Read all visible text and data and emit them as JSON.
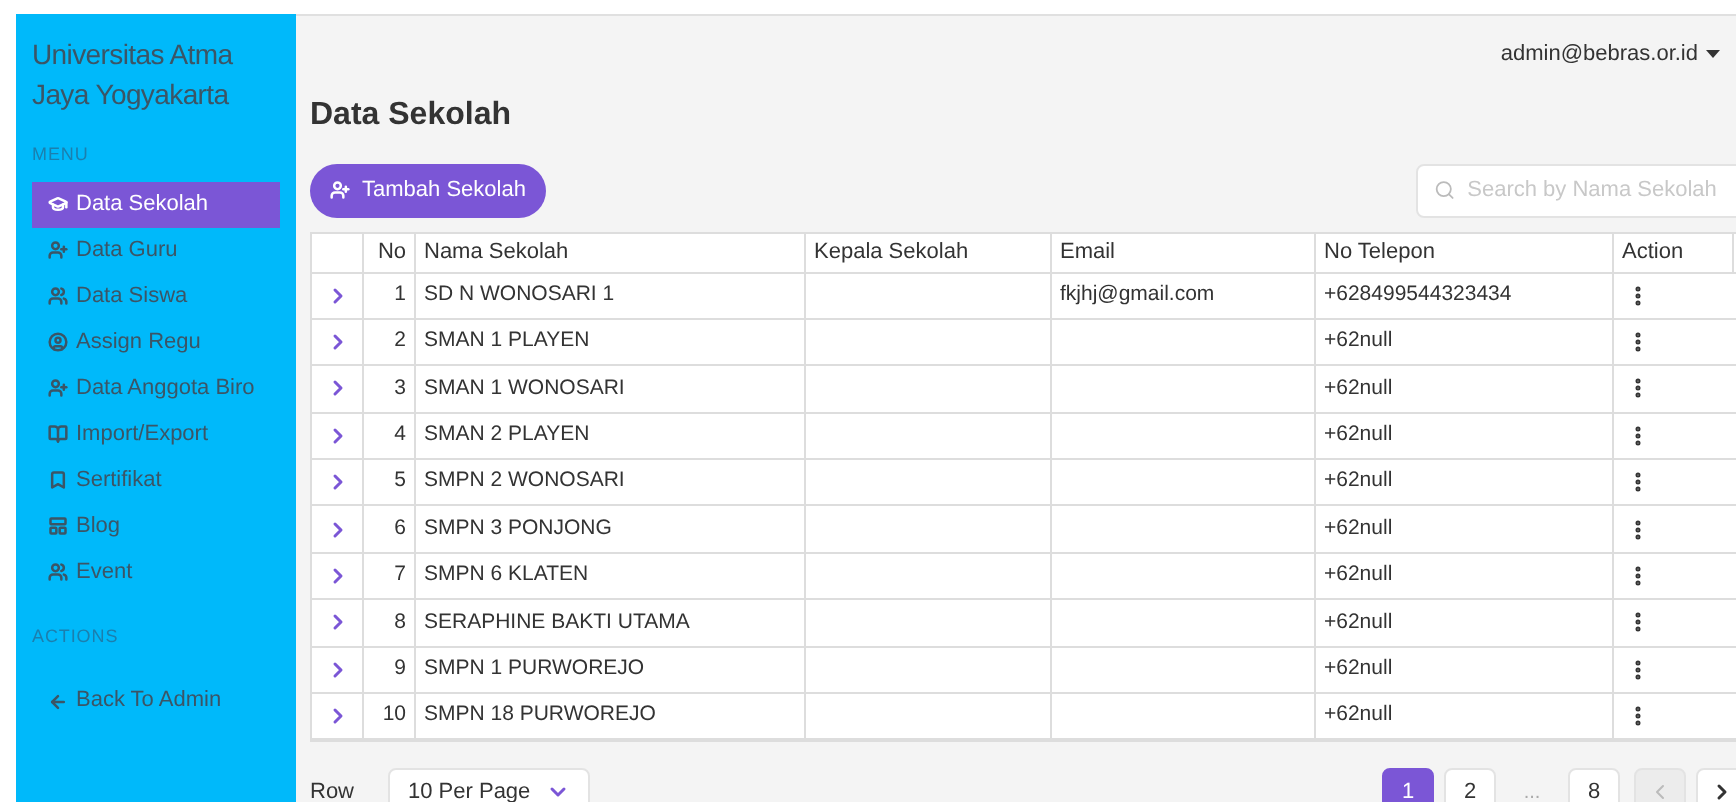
{
  "sidebar": {
    "brand": "Universitas Atma Jaya Yogyakarta",
    "sections": [
      {
        "heading": "MENU",
        "items": [
          {
            "label": "Data Sekolah",
            "selected": true
          },
          {
            "label": "Data Guru",
            "selected": false
          },
          {
            "label": "Data Siswa",
            "selected": false
          },
          {
            "label": "Assign Regu",
            "selected": false
          },
          {
            "label": "Data Anggota Biro",
            "selected": false
          },
          {
            "label": "Import/Export",
            "selected": false
          },
          {
            "label": "Sertifikat",
            "selected": false
          },
          {
            "label": "Blog",
            "selected": false
          },
          {
            "label": "Event",
            "selected": false
          }
        ]
      },
      {
        "heading": "ACTIONS",
        "items": [
          {
            "label": "Back To Admin",
            "selected": false
          }
        ]
      }
    ]
  },
  "user_menu": {
    "label": "admin@bebras.or.id"
  },
  "page_title": "Data Sekolah",
  "add_button": {
    "label": "Tambah Sekolah"
  },
  "search": {
    "placeholder": "Search by Nama Sekolah"
  },
  "table": {
    "columns": [
      "No",
      "Nama Sekolah",
      "Kepala Sekolah",
      "Email",
      "No Telepon",
      "Action"
    ],
    "rows": [
      {
        "no": "1",
        "nama": "SD N WONOSARI 1",
        "kepala": "",
        "email": "fkjhj@gmail.com",
        "telepon": "+628499544323434"
      },
      {
        "no": "2",
        "nama": "SMAN 1 PLAYEN",
        "kepala": "",
        "email": "",
        "telepon": "+62null"
      },
      {
        "no": "3",
        "nama": "SMAN 1 WONOSARI",
        "kepala": "",
        "email": "",
        "telepon": "+62null"
      },
      {
        "no": "4",
        "nama": "SMAN 2 PLAYEN",
        "kepala": "",
        "email": "",
        "telepon": "+62null"
      },
      {
        "no": "5",
        "nama": "SMPN 2 WONOSARI",
        "kepala": "",
        "email": "",
        "telepon": "+62null"
      },
      {
        "no": "6",
        "nama": "SMPN 3 PONJONG",
        "kepala": "",
        "email": "",
        "telepon": "+62null"
      },
      {
        "no": "7",
        "nama": "SMPN 6 KLATEN",
        "kepala": "",
        "email": "",
        "telepon": "+62null"
      },
      {
        "no": "8",
        "nama": "SERAPHINE BAKTI UTAMA",
        "kepala": "",
        "email": "",
        "telepon": "+62null"
      },
      {
        "no": "9",
        "nama": "SMPN 1 PURWOREJO",
        "kepala": "",
        "email": "",
        "telepon": "+62null"
      },
      {
        "no": "10",
        "nama": "SMPN 18 PURWOREJO",
        "kepala": "",
        "email": "",
        "telepon": "+62null"
      }
    ]
  },
  "footer": {
    "rows_label": "Row",
    "per_page": "10 Per Page",
    "pages": [
      {
        "kind": "page",
        "label": "1",
        "selected": true
      },
      {
        "kind": "page",
        "label": "2",
        "selected": false
      },
      {
        "kind": "ellipsis",
        "label": "..."
      },
      {
        "kind": "page",
        "label": "8",
        "selected": false
      }
    ],
    "prev": {
      "disabled": true
    },
    "next": {
      "disabled": false
    }
  }
}
